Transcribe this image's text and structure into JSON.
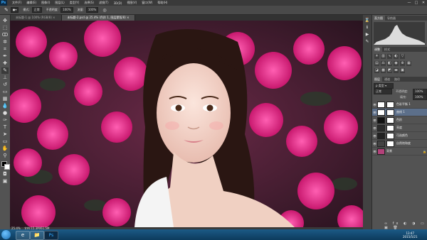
{
  "app": {
    "logo": "Ps"
  },
  "menu": [
    "文件(F)",
    "编辑(E)",
    "图像(I)",
    "图层(L)",
    "类型(Y)",
    "选择(S)",
    "滤镜(T)",
    "3D(D)",
    "视图(V)",
    "窗口(W)",
    "帮助(H)"
  ],
  "window_controls": [
    "—",
    "□",
    "✕"
  ],
  "options_bar": {
    "mode_label": "模式:",
    "mode_value": "正常",
    "opacity_label": "不透明度:",
    "opacity_value": "100%",
    "flow_label": "流量:",
    "flow_value": "100%"
  },
  "tabs": [
    {
      "label": "未标题-1 @ 100% (RGB/8) ×",
      "active": false
    },
    {
      "label": "未标题-2.psd @ 25.4% (色阶 1, 图层蒙版/8) ×",
      "active": true
    }
  ],
  "status": {
    "zoom": "25.4%",
    "doc": "文档:15.3M/61.5M"
  },
  "panels": {
    "top_tabs": [
      "直方图",
      "导航器"
    ],
    "mid_tabs": [
      "调整",
      "样式"
    ],
    "layers_tabs": [
      "图层",
      "通道",
      "路径"
    ],
    "blend_mode": "正常",
    "opacity_label": "不透明度:",
    "opacity_value": "100%",
    "fill_label": "填充:",
    "fill_value": "100%",
    "layers": [
      {
        "name": "色彩平衡 1",
        "thumb": "#ffffff",
        "mask": true,
        "selected": false
      },
      {
        "name": "曲线 1",
        "thumb": "#ffffff",
        "mask": true,
        "selected": true
      },
      {
        "name": "色阶",
        "thumb": "#111111",
        "mask": true,
        "selected": false
      },
      {
        "name": "亮度",
        "thumb": "#2b2b2b",
        "mask": true,
        "selected": false
      },
      {
        "name": "可选颜色",
        "thumb": "#222222",
        "mask": true,
        "selected": false
      },
      {
        "name": "自然饱和度",
        "thumb": "#444444",
        "mask": true,
        "selected": false
      },
      {
        "name": "背景",
        "thumb": "#b3417a",
        "mask": false,
        "selected": false
      }
    ]
  },
  "taskbar": {
    "apps": [
      "e",
      "📁",
      "Ps"
    ],
    "time": "13:47",
    "date": "2015/5/21"
  },
  "colors": {
    "accent_selected": "#5c6f8a",
    "taskbar": "#1c5a86",
    "ps_blue": "#31a8ff"
  }
}
